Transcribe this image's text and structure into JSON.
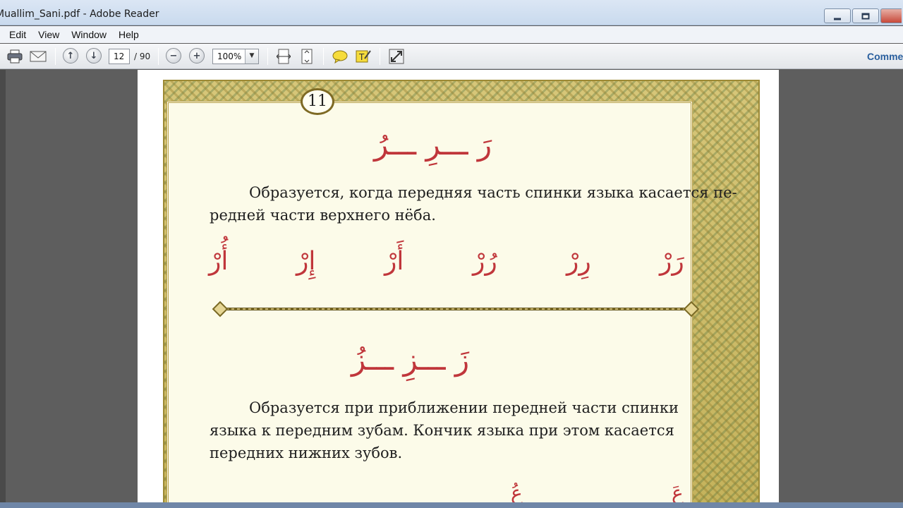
{
  "window": {
    "title": "Muallim_Sani.pdf - Adobe Reader"
  },
  "menu": [
    "Edit",
    "View",
    "Window",
    "Help"
  ],
  "toolbar": {
    "current_page": "12",
    "total_pages": "/ 90",
    "zoom": "100%",
    "comment_label": "Comme"
  },
  "document": {
    "page_number": "11",
    "section1": {
      "letters_heading": "رَ ـــرِ ـــرُ",
      "paragraph_line1": "Образуется, когда передняя часть спинки языка касается пе-",
      "paragraph_line2": "редней части верхнего нёба.",
      "syllables": [
        "رَرْ",
        "رِرْ",
        "رُرْ",
        "أَرْ",
        "إِرْ",
        "أُرْ"
      ]
    },
    "section2": {
      "letters_heading": "زَ ـــزِ ـــزُ",
      "paragraph_line1": "Образуется при приближении передней части спинки",
      "paragraph_line2": "языка к передним зубам. Кончик языка при этом касается",
      "paragraph_line3": "передних нижних зубов.",
      "partial_syllables": [
        "عَ",
        "عُ"
      ]
    }
  },
  "colors": {
    "arabic_text": "#c0363b",
    "ornament_gold": "#c4b25b"
  }
}
